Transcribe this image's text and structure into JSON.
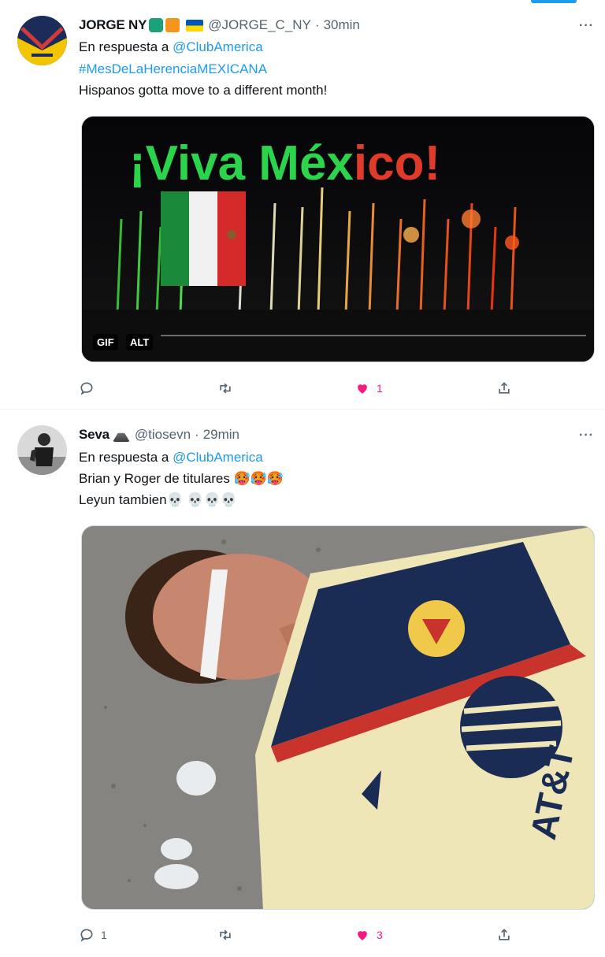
{
  "tweets": [
    {
      "display_name": "JORGE NY",
      "handle": "@JORGE_C_NY",
      "dot": "·",
      "time": "30min",
      "reply_prefix": "En respuesta a",
      "reply_to": "@ClubAmerica",
      "hashtag": "#MesDeLaHerenciaMEXICANA",
      "text": "Hispanos gotta move to a different month!",
      "media": {
        "overlay_text": [
          "¡Viva Méx",
          "ic",
          "o!"
        ],
        "gif_label": "GIF",
        "alt_label": "ALT"
      },
      "actions": {
        "replies": "",
        "retweets": "",
        "likes": "1"
      },
      "more": "···"
    },
    {
      "display_name": "Seva",
      "handle": "@tiosevn",
      "dot": "·",
      "time": "29min",
      "reply_prefix": "En respuesta a",
      "reply_to": "@ClubAmerica",
      "text_line1": "Brian y Roger de titulares 🥵🥵🥵",
      "text_line2": "Leyun tambien💀 💀💀💀",
      "actions": {
        "replies": "1",
        "retweets": "",
        "likes": "3"
      },
      "more": "···"
    }
  ],
  "colors": {
    "link": "#1d9bf0",
    "like": "#f91880",
    "muted": "#536471"
  },
  "icons": [
    "reply-icon",
    "retweet-icon",
    "heart-icon",
    "share-icon",
    "more-icon"
  ]
}
